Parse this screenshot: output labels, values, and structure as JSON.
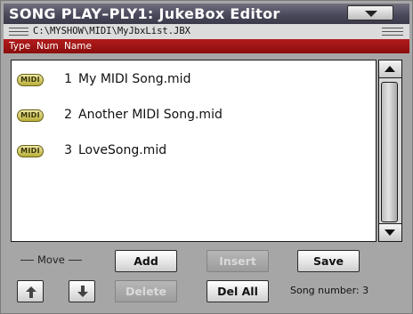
{
  "window": {
    "title": "SONG PLAY–PLY1: JukeBox Editor",
    "menu_icon": "chevron-down-icon"
  },
  "path": "C:\\MYSHOW\\MIDI\\MyJbxList.JBX",
  "columns": {
    "type": "Type",
    "num": "Num",
    "name": "Name"
  },
  "songs": [
    {
      "type": "MIDI",
      "num": "1",
      "name": "My MIDI Song.mid"
    },
    {
      "type": "MIDI",
      "num": "2",
      "name": "Another MIDI Song.mid"
    },
    {
      "type": "MIDI",
      "num": "3",
      "name": "LoveSong.mid"
    }
  ],
  "controls": {
    "move_label": "Move",
    "add": "Add",
    "insert": "Insert",
    "save": "Save",
    "delete": "Delete",
    "delete_all": "Del All",
    "song_number_label": "Song number:",
    "song_number_value": "3"
  },
  "colors": {
    "title_bg": "#4b4a5c",
    "header_bg": "#a11414",
    "panel_bg": "#a7a6a6",
    "midi_badge": "#d6cf63"
  }
}
